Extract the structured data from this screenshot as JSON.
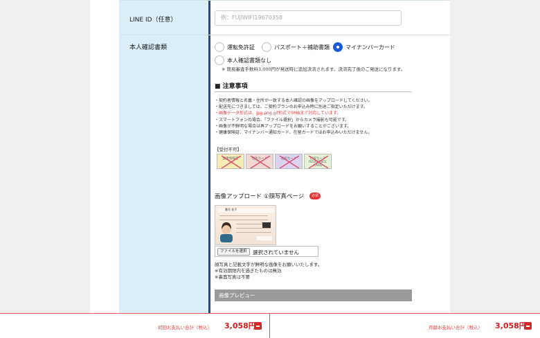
{
  "form": {
    "line_id": {
      "label": "LINE ID（任意）",
      "placeholder": "例：FUJIWIFI19670358"
    },
    "identity": {
      "label": "本人確認書類",
      "options": [
        "運転免許証",
        "パスポート＋補助書類",
        "マイナンバーカード",
        "本人確認書類なし"
      ],
      "selected": "マイナンバーカード",
      "fee_note": "※ 簡易審査手数料3,000円が発送時に追加決済されます。決済完了後のご発送になります。"
    }
  },
  "notes": {
    "heading": "■ 注意事項",
    "items": [
      "・契約者情報と名義・住所が一致する本人確認の画像をアップロードしてください。",
      "・配送先につきましては、ご契約プランのお申込み時に別途ご指定いただけます。",
      "・画像データ形式は、jpg,png,gif形式で5MBまで対応しています。",
      "・スマートフォンの場合、「ファイル選択」からカメラ撮影も可能です。",
      "・画像が不鮮明な場合は再アップロードをお願いすることがございます。",
      "・健康保険証、マイナンバー通知カード、在留カードではお申込みいただけません。"
    ],
    "unaccepted_label": "【受付不可】",
    "unaccepted_cards": [
      "健康保険証",
      "住民カード",
      "通知カード",
      "在留カード RESIDENCE CARD"
    ],
    "colors": {
      "red_note": "#e23b3b"
    }
  },
  "upload": {
    "heading": "画像アップロード ①顔写真ページ",
    "required_badge": "必須",
    "card_name": "番号 花子",
    "file_button": "ファイルを選択",
    "file_status": "選択されていません",
    "notes": [
      "顔写真と記載文字が鮮明な画像をお願いいたします。",
      "※有効期限内を過ぎたものは無効",
      "※裏面写真は不要"
    ],
    "preview_label": "画像プレビュー"
  },
  "footer": {
    "first_label": "初回お支払い合計（税込）",
    "first_price": "3,058円",
    "monthly_label": "月額お支払い合計（税込）",
    "monthly_price": "3,058円"
  }
}
